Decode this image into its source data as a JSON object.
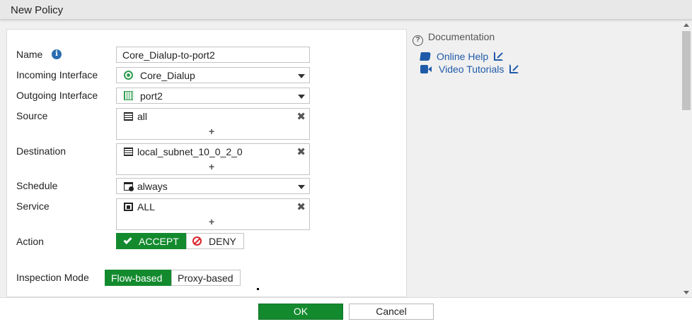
{
  "window": {
    "title": "New Policy"
  },
  "form": {
    "name": {
      "label": "Name",
      "value": "Core_Dialup-to-port2"
    },
    "incoming_interface": {
      "label": "Incoming Interface",
      "value": "Core_Dialup"
    },
    "outgoing_interface": {
      "label": "Outgoing Interface",
      "value": "port2"
    },
    "source": {
      "label": "Source",
      "value": "all",
      "add": "+"
    },
    "destination": {
      "label": "Destination",
      "value": "local_subnet_10_0_2_0",
      "add": "+"
    },
    "schedule": {
      "label": "Schedule",
      "value": "always"
    },
    "service": {
      "label": "Service",
      "value": "ALL",
      "add": "+"
    },
    "action": {
      "label": "Action",
      "options": [
        "ACCEPT",
        "DENY"
      ],
      "selected": "ACCEPT"
    },
    "inspection_mode": {
      "label": "Inspection Mode",
      "options": [
        "Flow-based",
        "Proxy-based"
      ],
      "selected": "Flow-based"
    }
  },
  "documentation": {
    "heading": "Documentation",
    "links": [
      "Online Help",
      "Video Tutorials"
    ]
  },
  "footer": {
    "ok": "OK",
    "cancel": "Cancel"
  },
  "colors": {
    "accent_green": "#138a2e",
    "link_blue": "#1f5aa8",
    "deny_red": "#d8232a"
  }
}
